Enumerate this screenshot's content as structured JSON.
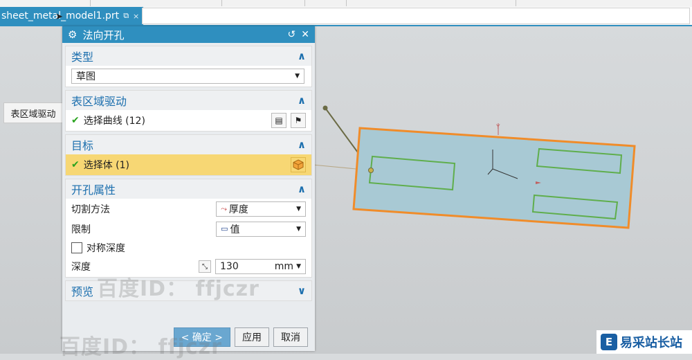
{
  "tab": {
    "title": "sheet_metal_model1.prt",
    "pin_icon": "pin-icon",
    "close_glyph": "×"
  },
  "side_tab": {
    "label": "表区域驱动"
  },
  "dialog": {
    "title": "法向开孔",
    "gear_glyph": "⚙",
    "reset_glyph": "↺",
    "close_glyph": "✕",
    "sections": {
      "type": {
        "title": "类型",
        "value": "草图"
      },
      "region": {
        "title": "表区域驱动",
        "select_label": "选择曲线 (12)"
      },
      "target": {
        "title": "目标",
        "select_label": "选择体 (1)"
      },
      "props": {
        "title": "开孔属性",
        "cut_method_label": "切割方法",
        "cut_method_value": "厚度",
        "limit_label": "限制",
        "limit_value": "值",
        "symmetric_label": "对称深度",
        "depth_label": "深度",
        "depth_value": "130",
        "depth_unit": "mm"
      },
      "preview": {
        "title": "预览"
      }
    },
    "buttons": {
      "ok": "< 确定 >",
      "apply": "应用",
      "cancel": "取消"
    }
  },
  "watermark": {
    "text1": "百度ID： ffjczr",
    "text2": "百度ID： ffjczr"
  },
  "logo": {
    "text": "易采站长站",
    "mark": "E"
  },
  "colors": {
    "accent": "#2f8fbf",
    "title_text": "#1c6fae",
    "highlight": "#f7d774",
    "part_outline": "#f08c2a",
    "cutout": "#5fae4c",
    "part_fill": "#a8c9d4"
  }
}
